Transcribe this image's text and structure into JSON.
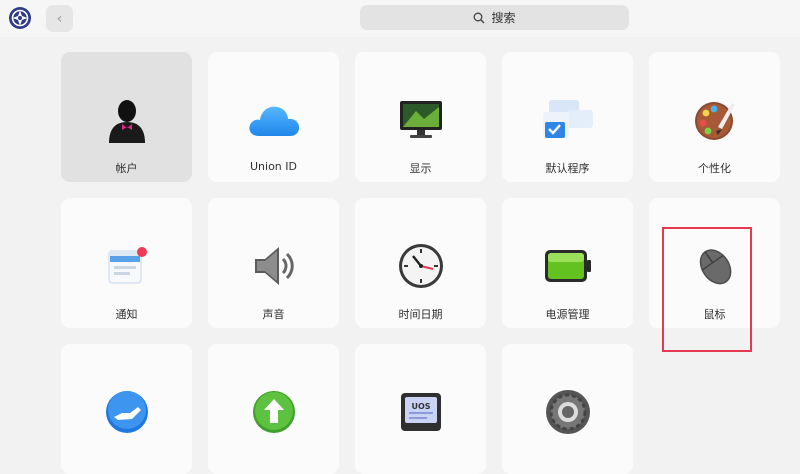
{
  "header": {
    "search_placeholder": "搜索",
    "back_icon": "chevron-left-icon",
    "logo_icon": "control-center-logo-icon"
  },
  "tiles": [
    {
      "label": "帐户",
      "icon": "account-icon",
      "selected": true
    },
    {
      "label": "Union ID",
      "icon": "cloud-icon"
    },
    {
      "label": "显示",
      "icon": "display-icon"
    },
    {
      "label": "默认程序",
      "icon": "default-apps-icon"
    },
    {
      "label": "个性化",
      "icon": "palette-icon"
    },
    {
      "label": "通知",
      "icon": "notification-icon"
    },
    {
      "label": "声音",
      "icon": "speaker-icon"
    },
    {
      "label": "时间日期",
      "icon": "clock-icon"
    },
    {
      "label": "电源管理",
      "icon": "battery-icon"
    },
    {
      "label": "鼠标",
      "icon": "mouse-icon",
      "highlighted": true
    },
    {
      "label": "",
      "icon": "assistance-hand-icon"
    },
    {
      "label": "",
      "icon": "update-arrow-icon"
    },
    {
      "label": "",
      "icon": "uos-system-info-icon"
    },
    {
      "label": "",
      "icon": "general-settings-gear-icon"
    }
  ],
  "colors": {
    "highlight": "#e53950",
    "accent": "#2f7de1"
  }
}
